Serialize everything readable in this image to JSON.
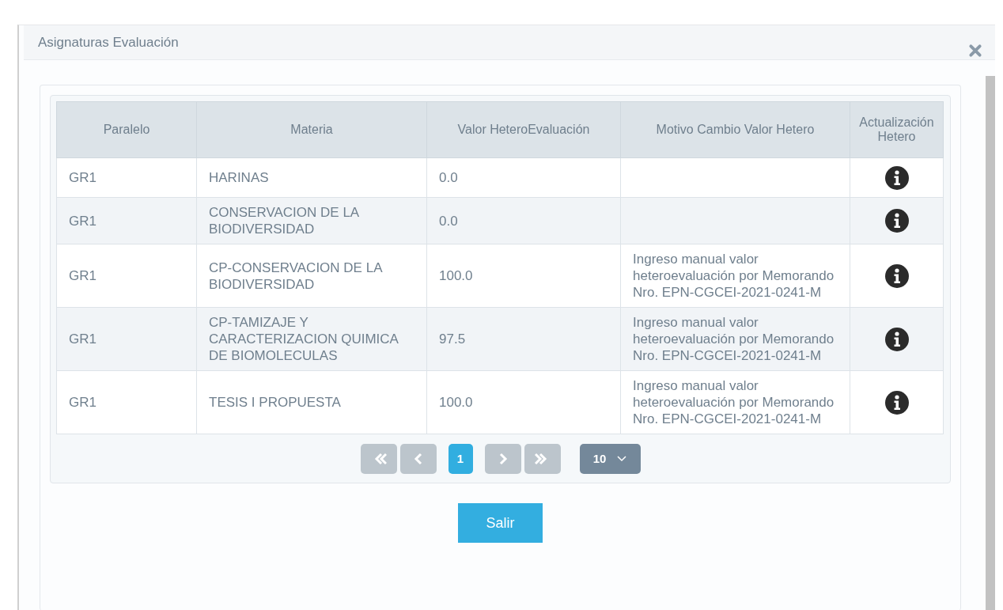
{
  "dialog": {
    "title": "Asignaturas Evaluación"
  },
  "table": {
    "columns": [
      "Paralelo",
      "Materia",
      "Valor HeteroEvaluación",
      "Motivo Cambio Valor Hetero",
      "Actualización Hetero"
    ],
    "rows": [
      {
        "paralelo": "GR1",
        "materia": "HARINAS",
        "valor": "0.0",
        "motivo": ""
      },
      {
        "paralelo": "GR1",
        "materia": "CONSERVACION DE LA BIODIVERSIDAD",
        "valor": "0.0",
        "motivo": ""
      },
      {
        "paralelo": "GR1",
        "materia": "CP-CONSERVACION DE LA BIODIVERSIDAD",
        "valor": "100.0",
        "motivo": "Ingreso manual valor heteroevaluación por Memorando Nro. EPN-CGCEI-2021-0241-M"
      },
      {
        "paralelo": "GR1",
        "materia": "CP-TAMIZAJE Y CARACTERIZACION QUIMICA DE BIOMOLECULAS",
        "valor": "97.5",
        "motivo": "Ingreso manual valor heteroevaluación por Memorando Nro. EPN-CGCEI-2021-0241-M"
      },
      {
        "paralelo": "GR1",
        "materia": "TESIS I PROPUESTA",
        "valor": "100.0",
        "motivo": "Ingreso manual valor heteroevaluación por Memorando Nro. EPN-CGCEI-2021-0241-M"
      }
    ]
  },
  "pagination": {
    "nav": [
      {
        "kind": "first",
        "disabled": true
      },
      {
        "kind": "prev",
        "disabled": true
      }
    ],
    "pages": [
      {
        "label": "1",
        "selected": true
      }
    ],
    "nav_after": [
      {
        "kind": "next",
        "disabled": true
      },
      {
        "kind": "last",
        "disabled": true
      }
    ],
    "page_size": "10"
  },
  "footer": {
    "button": "Salir"
  }
}
